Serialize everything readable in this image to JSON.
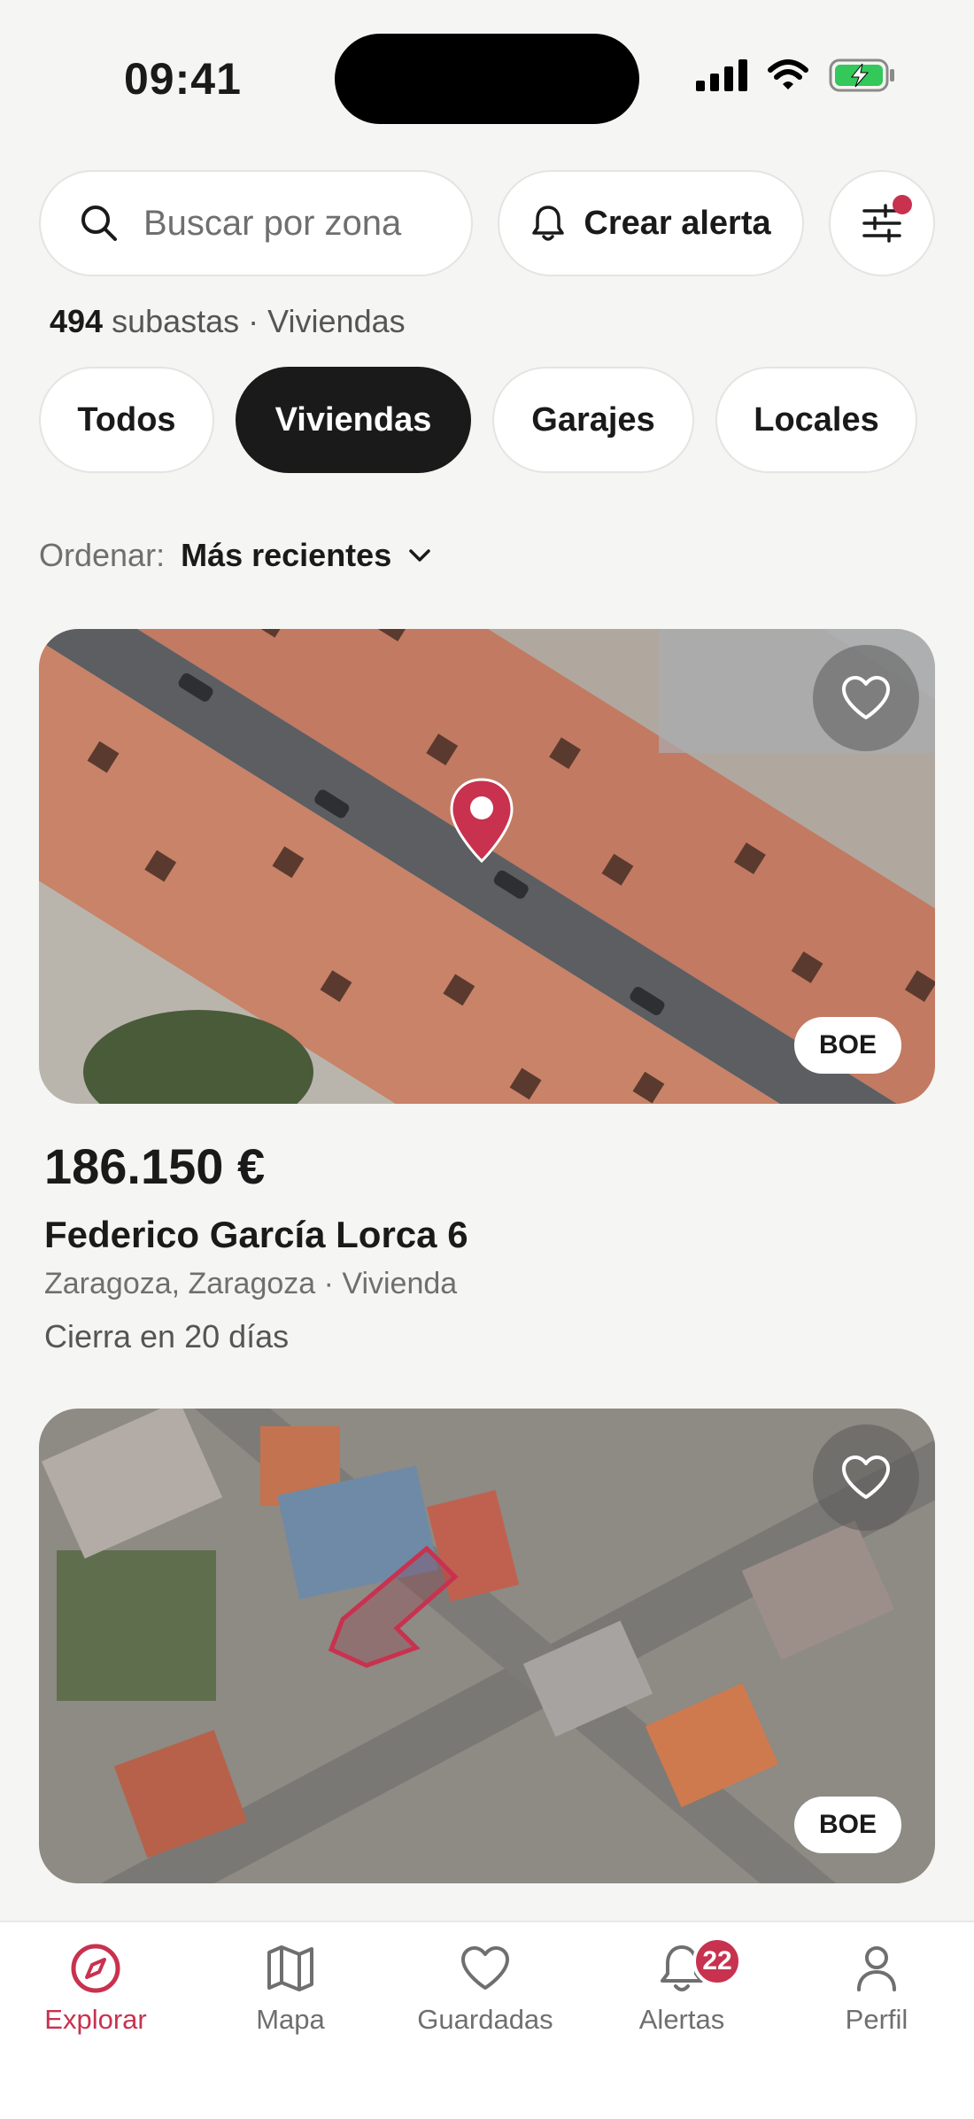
{
  "status_bar": {
    "time": "09:41"
  },
  "search": {
    "placeholder": "Buscar por zona",
    "value": ""
  },
  "alert_button": {
    "label": "Crear alerta"
  },
  "results": {
    "count": "494",
    "text": "subastas · Viviendas"
  },
  "categories": [
    {
      "label": "Todos",
      "active": false
    },
    {
      "label": "Viviendas",
      "active": true
    },
    {
      "label": "Garajes",
      "active": false
    },
    {
      "label": "Locales",
      "active": false
    }
  ],
  "sort": {
    "label": "Ordenar:",
    "value": "Más recientes"
  },
  "listings": [
    {
      "badge": "BOE",
      "price": "186.150 €",
      "address": "Federico García Lorca 6",
      "meta": "Zaragoza, Zaragoza · Vivienda",
      "closes": "Cierra en 20 días"
    },
    {
      "badge": "BOE"
    }
  ],
  "tabs": [
    {
      "label": "Explorar",
      "icon": "compass-icon",
      "active": true
    },
    {
      "label": "Mapa",
      "icon": "map-icon",
      "active": false
    },
    {
      "label": "Guardadas",
      "icon": "heart-icon",
      "active": false
    },
    {
      "label": "Alertas",
      "icon": "bell-icon",
      "active": false,
      "badge": "22"
    },
    {
      "label": "Perfil",
      "icon": "user-icon",
      "active": false
    }
  ],
  "colors": {
    "accent": "#c8324f",
    "background": "#f5f5f3",
    "active_pill": "#1a1a1a"
  }
}
